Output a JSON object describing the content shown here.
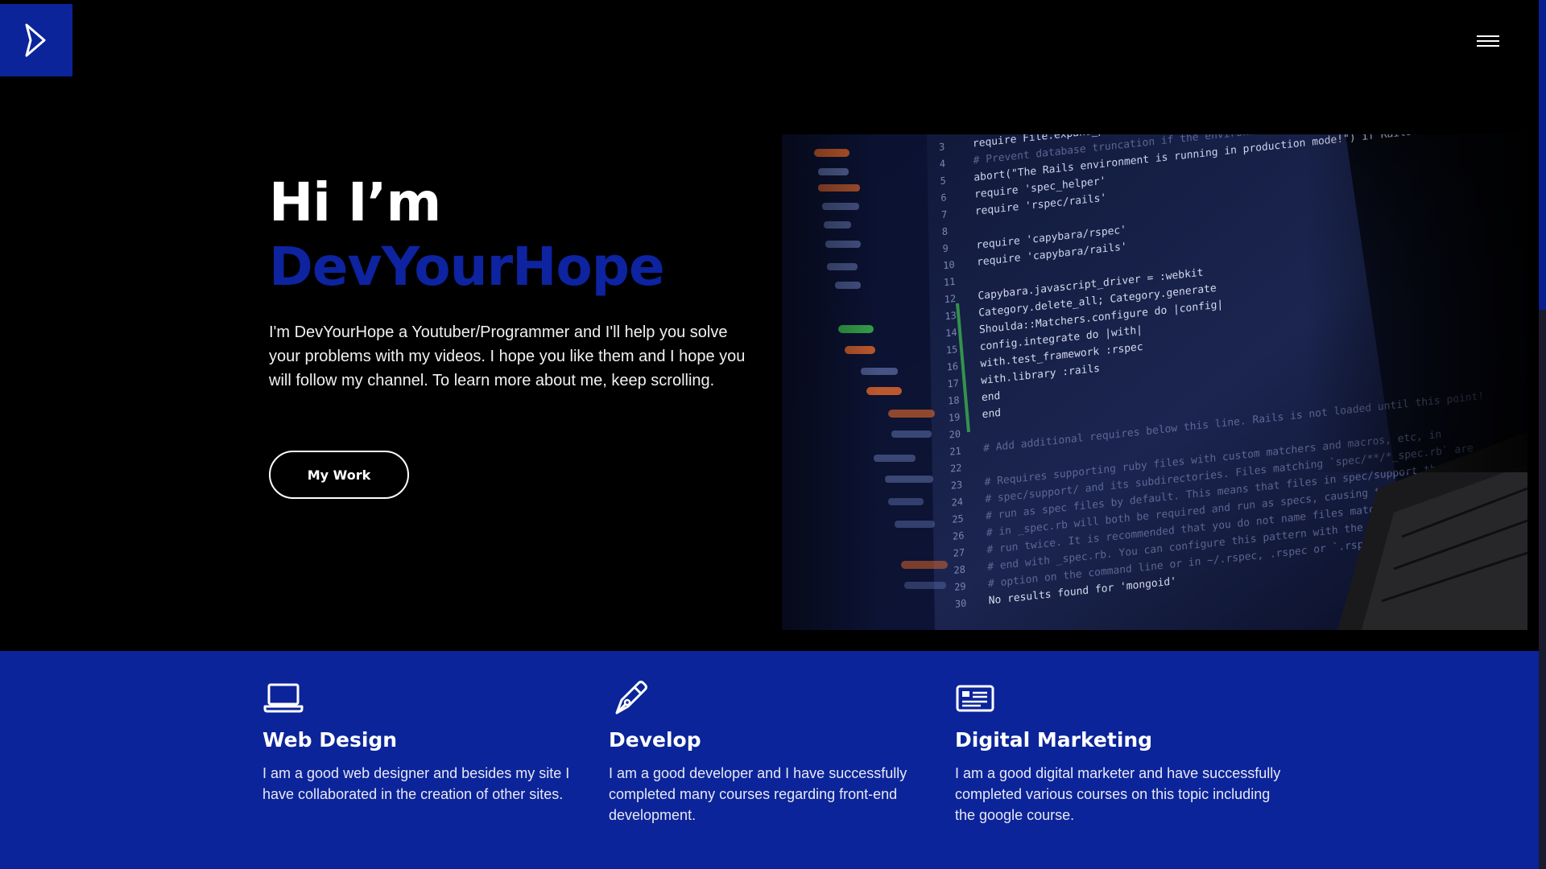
{
  "header": {
    "logo_icon": "chevron-right-icon",
    "menu_icon": "hamburger-menu-icon"
  },
  "hero": {
    "greeting": "Hi I’m",
    "name": "DevYourHope",
    "description": "I'm DevYourHope a Youtuber/Programmer and I'll help you solve your problems with my videos. I hope you like them and I hope you will follow my channel. To learn more about me, keep scrolling.",
    "button_label": "My Work",
    "image_alt": "laptop-code-image"
  },
  "services": [
    {
      "icon": "laptop-icon",
      "title": "Web Design",
      "description": "I am a good web designer and besides my site I have collaborated in the creation of other sites."
    },
    {
      "icon": "pen-nib-icon",
      "title": "Develop",
      "description": "I am a good developer and I have successfully completed many courses regarding front-end development."
    },
    {
      "icon": "newspaper-icon",
      "title": "Digital Marketing",
      "description": "I am a good digital marketer and have successfully completed various courses on this topic including the google course."
    }
  ],
  "code_lines": [
    {
      "num": "3",
      "text": "require File.expand_path('../../config/environment', __FILE__)"
    },
    {
      "num": "4",
      "text": "# Prevent database truncation if the environment is production"
    },
    {
      "num": "5",
      "text": "abort(\"The Rails environment is running in production mode!\") if Rails.env.production?"
    },
    {
      "num": "6",
      "text": "require 'spec_helper'"
    },
    {
      "num": "7",
      "text": "require 'rspec/rails'"
    },
    {
      "num": "8",
      "text": ""
    },
    {
      "num": "9",
      "text": "require 'capybara/rspec'"
    },
    {
      "num": "10",
      "text": "require 'capybara/rails'"
    },
    {
      "num": "11",
      "text": ""
    },
    {
      "num": "12",
      "text": "Capybara.javascript_driver = :webkit"
    },
    {
      "num": "13",
      "text": "Category.delete_all; Category.generate"
    },
    {
      "num": "14",
      "text": "Shoulda::Matchers.configure do |config|"
    },
    {
      "num": "15",
      "text": "config.integrate do |with|"
    },
    {
      "num": "16",
      "text": "with.test_framework :rspec"
    },
    {
      "num": "17",
      "text": "with.library :rails"
    },
    {
      "num": "18",
      "text": "end"
    },
    {
      "num": "19",
      "text": "end"
    },
    {
      "num": "20",
      "text": ""
    },
    {
      "num": "21",
      "text": "# Add additional requires below this line. Rails is not loaded until this point!"
    },
    {
      "num": "22",
      "text": ""
    },
    {
      "num": "23",
      "text": "# Requires supporting ruby files with custom matchers and macros, etc, in"
    },
    {
      "num": "24",
      "text": "# spec/support/ and its subdirectories. Files matching `spec/**/*_spec.rb` are"
    },
    {
      "num": "25",
      "text": "# run as spec files by default. This means that files in spec/support that end"
    },
    {
      "num": "26",
      "text": "# in _spec.rb will both be required and run as specs, causing the specs to be"
    },
    {
      "num": "27",
      "text": "# run twice. It is recommended that you do not name files matching this glob to"
    },
    {
      "num": "28",
      "text": "# end with _spec.rb. You can configure this pattern with the --pattern"
    },
    {
      "num": "29",
      "text": "# option on the command line or in ~/.rspec, .rspec or `.rspec-local`."
    },
    {
      "num": "30",
      "text": "No results found for 'mongoid'"
    }
  ]
}
